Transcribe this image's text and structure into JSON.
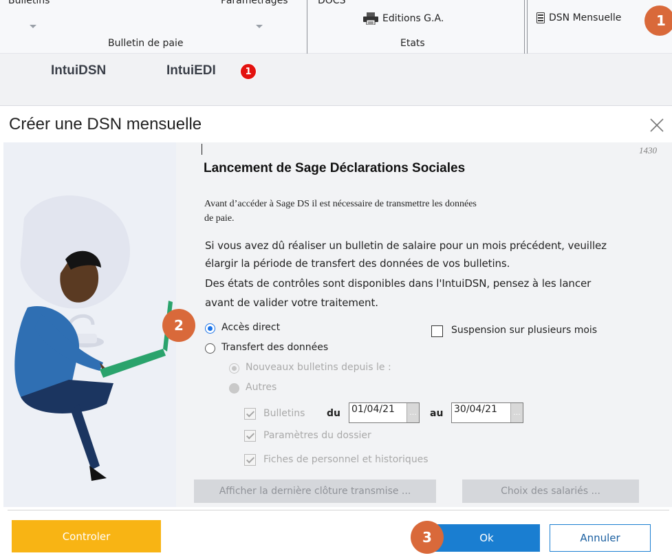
{
  "ribbon": {
    "bulletins_label": "Bulletins",
    "parametrages_label": "Paramétrages",
    "docs_label": "DOCS",
    "group_paie": "Bulletin de paie",
    "editions_label": "Editions G.A.",
    "group_etats": "Etats",
    "dsn_mensuelle_label": "DSN Mensuelle",
    "step1_badge": "1"
  },
  "tabs": {
    "intuidsn": "IntuiDSN",
    "intuiedi": "IntuiEDI",
    "intuiedi_badge": "1"
  },
  "dialog": {
    "title": "Créer une DSN mensuelle",
    "code": "1430",
    "heading": "Lancement de Sage Déclarations Sociales",
    "intro_line1": "Avant d’accéder à Sage DS il est nécessaire de transmettre les données",
    "intro_line2": "de paie.",
    "info_line1": "Si vous avez dû réaliser un bulletin de salaire pour un mois précédent, veuillez",
    "info_line2": "élargir la période de transfert des données de vos bulletins.",
    "info_line3": "Des états de contrôles sont disponibles dans l'IntuiDSN, pensez à les lancer",
    "info_line4": "avant de valider votre traitement.",
    "step2_badge": "2",
    "step3_badge": "3",
    "options": {
      "acces_direct": "Accès direct",
      "transfert": "Transfert des données",
      "suspension": "Suspension sur plusieurs mois",
      "nouveaux": "Nouveaux bulletins depuis le :",
      "autres": "Autres",
      "bulletins": "Bulletins",
      "du_label": "du",
      "date_from": "01/04/21",
      "au_label": "au",
      "date_to": "30/04/21",
      "date_btn": "...",
      "parametres": "Paramètres  du dossier",
      "fiches": "Fiches de personnel et historiques"
    },
    "btn_afficher": "Afficher la dernière clôture transmise ...",
    "btn_choix": "Choix des salariés ...",
    "btn_controler": "Controler",
    "btn_ok": "Ok",
    "btn_annuler": "Annuler"
  },
  "colors": {
    "accent": "#1a7ed1",
    "step_badge": "#d9693a",
    "controler": "#f8b414",
    "notif_badge": "#e3120f"
  }
}
